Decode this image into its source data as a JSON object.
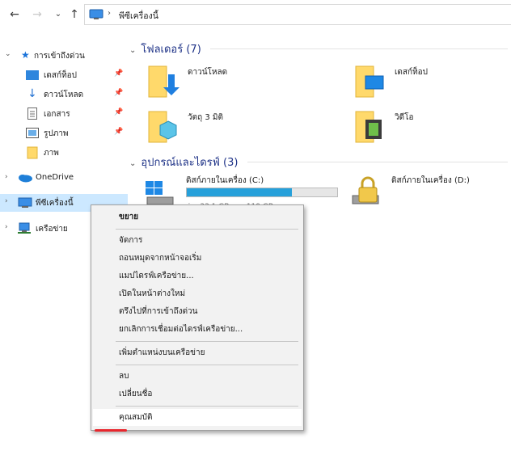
{
  "nav": {
    "back": "←",
    "forward": "→",
    "recent": "⌄",
    "up": "↑",
    "breadcrumb_sep": "›",
    "path": "พีซีเครื่องนี้"
  },
  "sidebar": {
    "quick_access": "การเข้าถึงด่วน",
    "items": [
      {
        "label": "เดสก์ท็อป"
      },
      {
        "label": "ดาวน์โหลด"
      },
      {
        "label": "เอกสาร"
      },
      {
        "label": "รูปภาพ"
      },
      {
        "label": "ภาพ"
      }
    ],
    "onedrive": "OneDrive",
    "this_pc": "พีซีเครื่องนี้",
    "network": "เครือข่าย"
  },
  "main": {
    "folders_header": "โฟลเดอร์ (7)",
    "folders": [
      {
        "label": "ดาวน์โหลด"
      },
      {
        "label": "เดสก์ท็อป"
      },
      {
        "label": "วัตถุ 3 มิติ"
      },
      {
        "label": "วิดีโอ"
      }
    ],
    "devices_header": "อุปกรณ์และไดรฟ์ (3)",
    "drives": [
      {
        "name": "ดิสก์ภายในเครื่อง (C:)",
        "usage": 0.7,
        "size_text": "ว่าง 33.1 GB จาก 119 GB"
      },
      {
        "name": "ดิสก์ภายในเครื่อง (D:)"
      }
    ]
  },
  "context_menu": {
    "items": [
      "ขยาย",
      "จัดการ",
      "ถอนหมุดจากหน้าจอเริ่ม",
      "แมปไดรฟ์เครือข่าย...",
      "เปิดในหน้าต่างใหม่",
      "ตรึงไปที่การเข้าถึงด่วน",
      "ยกเลิกการเชื่อมต่อไดรฟ์เครือข่าย...",
      "เพิ่มตำแหน่งบนเครือข่าย",
      "ลบ",
      "เปลี่ยนชื่อ",
      "คุณสมบัติ"
    ]
  },
  "colors": {
    "accent": "#26a0da",
    "selected": "#cce8ff",
    "header_blue": "#1e3287",
    "highlight_red": "#e8262d"
  }
}
